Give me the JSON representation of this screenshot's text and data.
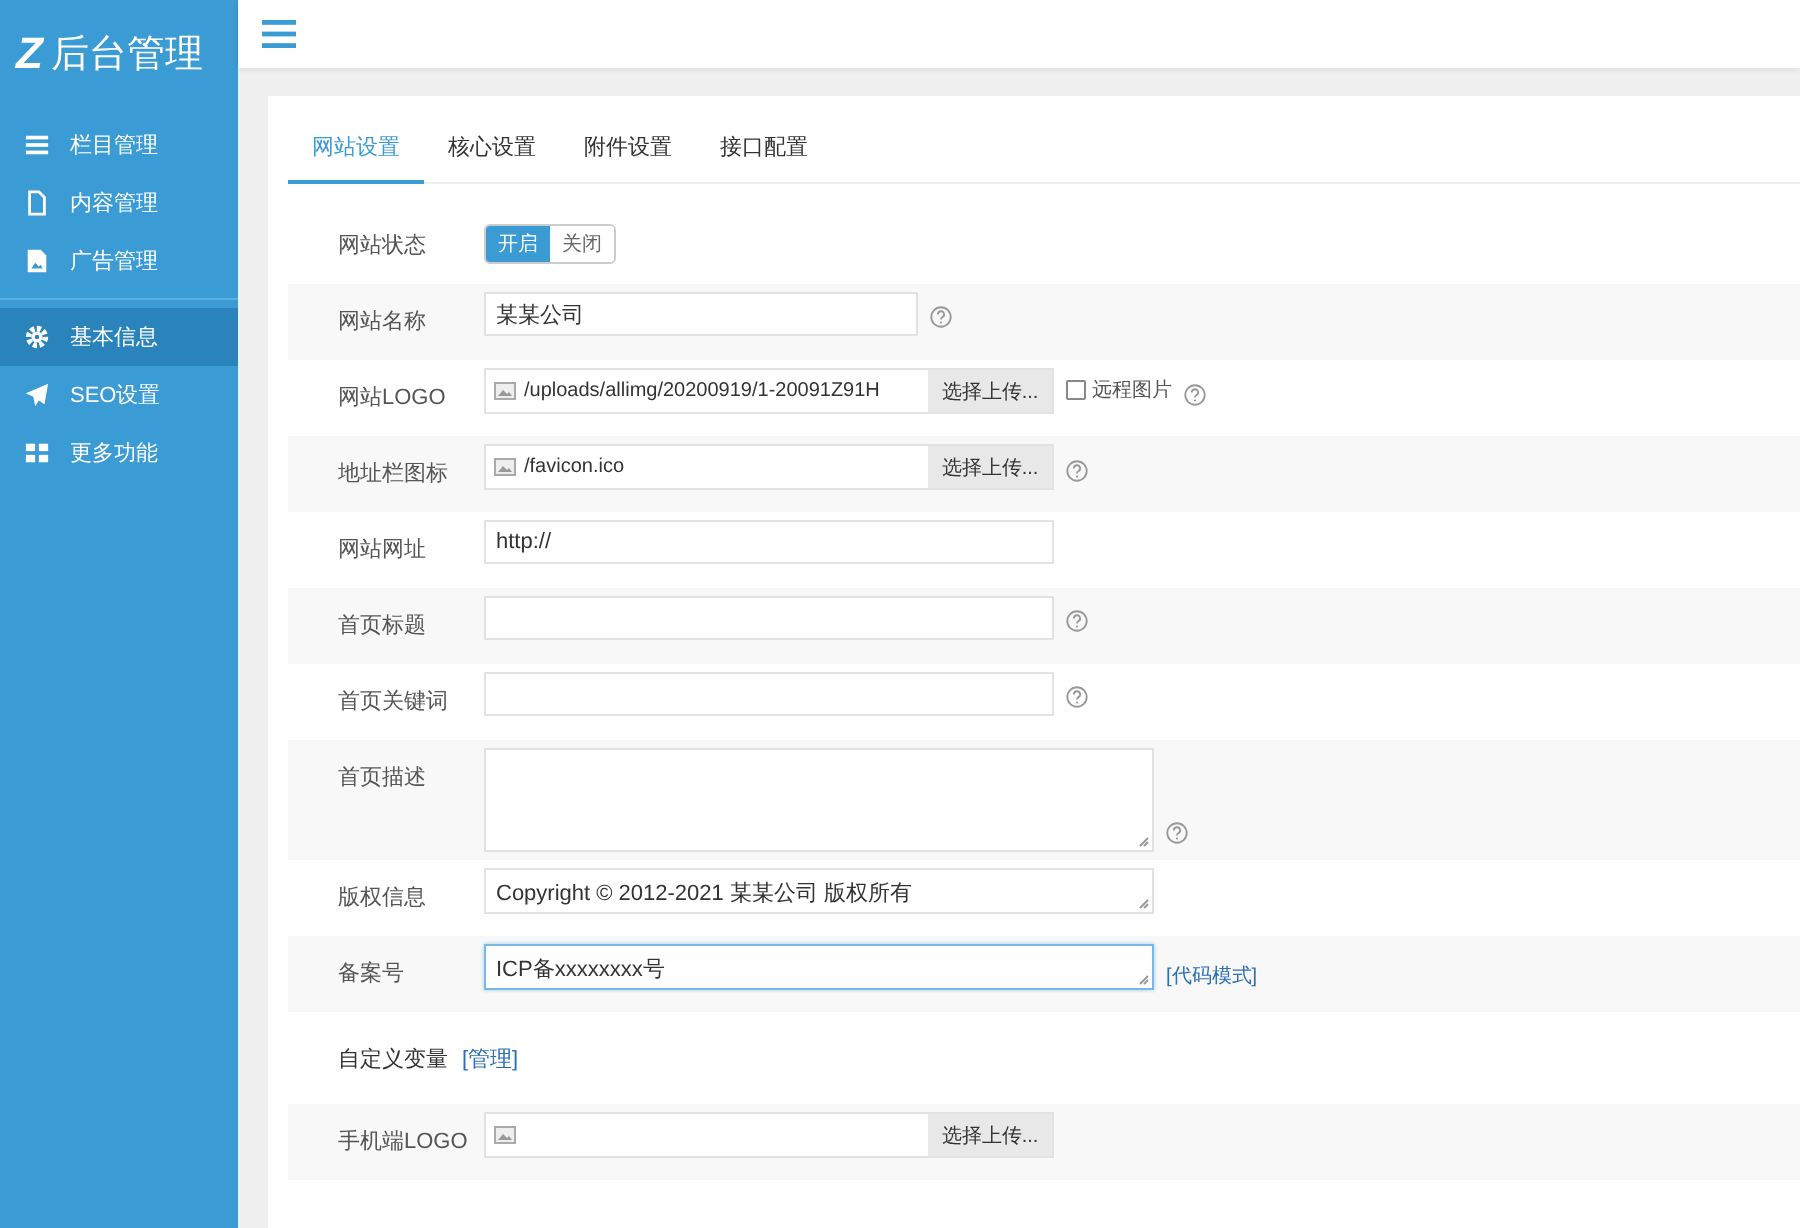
{
  "logo": {
    "mark": "Z",
    "text": "后台管理"
  },
  "sidebar": {
    "groups": [
      {
        "items": [
          {
            "label": "栏目管理",
            "selected": false
          },
          {
            "label": "内容管理",
            "selected": false
          },
          {
            "label": "广告管理",
            "selected": false
          }
        ]
      },
      {
        "items": [
          {
            "label": "基本信息",
            "selected": true
          },
          {
            "label": "SEO设置",
            "selected": false
          },
          {
            "label": "更多功能",
            "selected": false
          }
        ]
      }
    ]
  },
  "tabs": [
    {
      "label": "网站设置",
      "selected": true
    },
    {
      "label": "核心设置",
      "selected": false
    },
    {
      "label": "附件设置",
      "selected": false
    },
    {
      "label": "接口配置",
      "selected": false
    }
  ],
  "rows": [
    {
      "kind": "toggle",
      "label": "网站状态",
      "options": [
        {
          "label": "开启",
          "selected": true
        },
        {
          "label": "关闭",
          "selected": false
        }
      ]
    },
    {
      "kind": "text",
      "label": "网站名称",
      "value": "某某公司",
      "help": true
    },
    {
      "kind": "upload",
      "label": "网站LOGO",
      "value": "/uploads/allimg/20200919/1-20091Z91H",
      "button": "选择上传...",
      "checkbox": {
        "label": "远程图片",
        "checked": false
      },
      "help": true
    },
    {
      "kind": "upload",
      "label": "地址栏图标",
      "value": "/favicon.ico",
      "button": "选择上传...",
      "help": true
    },
    {
      "kind": "text",
      "label": "网站网址",
      "value": "http://",
      "help": false
    },
    {
      "kind": "text",
      "label": "首页标题",
      "help": true
    },
    {
      "kind": "text",
      "label": "首页关键词",
      "help": true
    },
    {
      "kind": "textarea",
      "label": "首页描述",
      "help": true,
      "focused": false
    },
    {
      "kind": "textarea",
      "label": "版权信息",
      "value": "Copyright © 2012-2021 某某公司 版权所有",
      "help": false,
      "focused": false
    },
    {
      "kind": "textarea",
      "label": "备案号",
      "value": "ICP备xxxxxxxx号",
      "help": false,
      "focused": true,
      "link": "[代码模式]"
    },
    {
      "kind": "section",
      "label": "自定义变量",
      "link": "[管理]"
    },
    {
      "kind": "upload",
      "label": "手机端LOGO",
      "button": "选择上传...",
      "help": false
    }
  ]
}
